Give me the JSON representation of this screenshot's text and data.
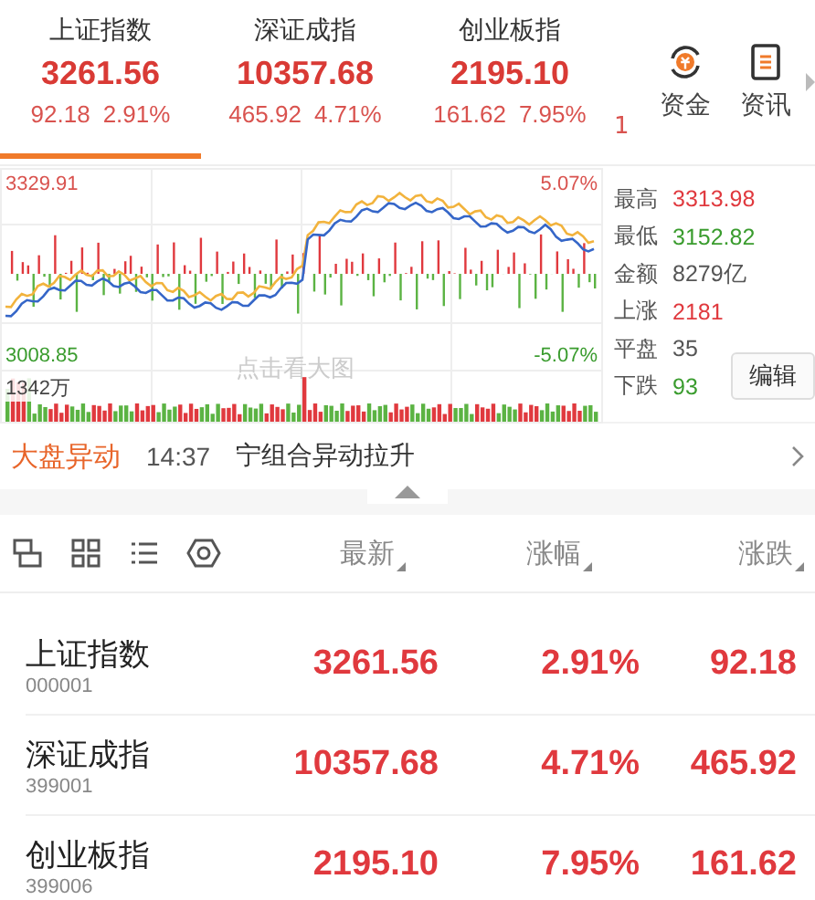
{
  "index_tabs": [
    {
      "name": "上证指数",
      "price": "3261.56",
      "change": "92.18",
      "pct": "2.91%",
      "selected": true
    },
    {
      "name": "深证成指",
      "price": "10357.68",
      "change": "465.92",
      "pct": "4.71%",
      "selected": false
    },
    {
      "name": "创业板指",
      "price": "2195.10",
      "change": "161.62",
      "pct": "7.95%",
      "selected": false
    }
  ],
  "index_tabs_peek": "1",
  "shortcuts": [
    "资金",
    "资讯"
  ],
  "chart": {
    "high_label": "3329.91",
    "high_pct": "5.07%",
    "low_label": "3008.85",
    "low_pct": "-5.07%",
    "volume_label": "1342万",
    "hint": "点击看大图"
  },
  "stats": [
    {
      "label": "最高",
      "value": "3313.98",
      "color": "#e0393e"
    },
    {
      "label": "最低",
      "value": "3152.82",
      "color": "#3a9c2e"
    },
    {
      "label": "金额",
      "value": "8279亿",
      "color": "#555555"
    },
    {
      "label": "上涨",
      "value": "2181",
      "color": "#e0393e"
    },
    {
      "label": "平盘",
      "value": "35",
      "color": "#555555"
    },
    {
      "label": "下跌",
      "value": "93",
      "color": "#3a9c2e"
    }
  ],
  "edit_button": "编辑",
  "ticker": {
    "tag": "大盘异动",
    "time": "14:37",
    "text": "宁组合异动拉升"
  },
  "columns": [
    "最新",
    "涨幅",
    "涨跌"
  ],
  "rows": [
    {
      "name": "上证指数",
      "code": "000001",
      "price": "3261.56",
      "pct": "2.91%",
      "change": "92.18"
    },
    {
      "name": "深证成指",
      "code": "399001",
      "price": "10357.68",
      "pct": "4.71%",
      "change": "465.92"
    },
    {
      "name": "创业板指",
      "code": "399006",
      "price": "2195.10",
      "pct": "7.95%",
      "change": "161.62"
    }
  ]
}
